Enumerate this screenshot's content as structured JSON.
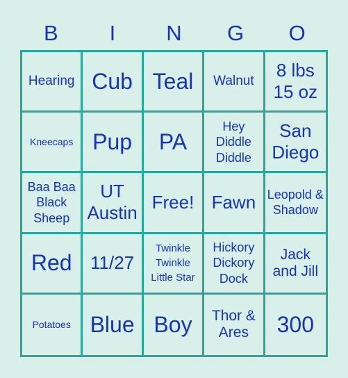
{
  "header": {
    "letters": [
      "B",
      "I",
      "N",
      "G",
      "O"
    ]
  },
  "colors": {
    "background": "#d9efea",
    "grid_line": "#26a89c",
    "text": "#1535b5"
  },
  "cells": [
    "Hearing",
    "Cub",
    "Teal",
    "Walnut",
    "8 lbs 15 oz",
    "Kneecaps",
    "Pup",
    "PA",
    "Hey Diddle Diddle",
    "San Diego",
    "Baa Baa Black Sheep",
    "UT Austin",
    "Free!",
    "Fawn",
    "Leopold & Shadow",
    "Red",
    "11/27",
    "Twinkle Twinkle Little Star",
    "Hickory Dickory Dock",
    "Jack and Jill",
    "Potatoes",
    "Blue",
    "Boy",
    "Thor & Ares",
    "300"
  ]
}
